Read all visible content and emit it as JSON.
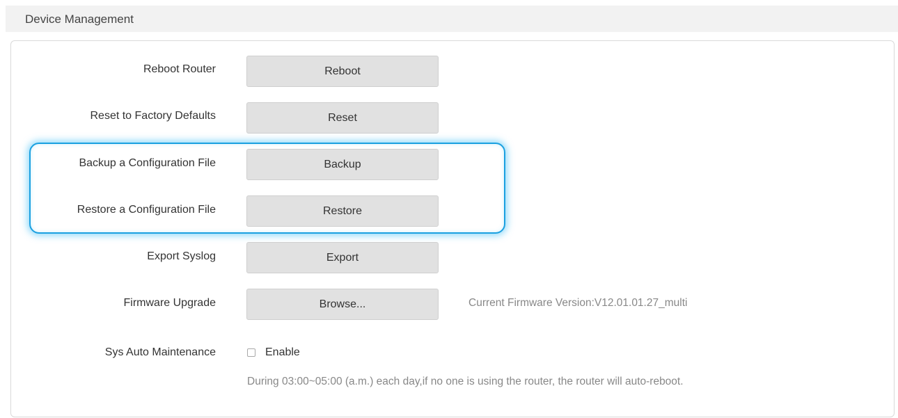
{
  "section": {
    "title": "Device Management"
  },
  "rows": {
    "reboot": {
      "label": "Reboot Router",
      "button": "Reboot"
    },
    "reset": {
      "label": "Reset to Factory Defaults",
      "button": "Reset"
    },
    "backup": {
      "label": "Backup a Configuration File",
      "button": "Backup"
    },
    "restore": {
      "label": "Restore a Configuration File",
      "button": "Restore"
    },
    "export": {
      "label": "Export Syslog",
      "button": "Export"
    },
    "firmware": {
      "label": "Firmware Upgrade",
      "button": "Browse...",
      "version_text": "Current Firmware Version:V12.01.01.27_multi"
    },
    "maintenance": {
      "label": "Sys Auto Maintenance",
      "checkbox_label": "Enable",
      "checked": false,
      "note": "During 03:00~05:00 (a.m.) each day,if no one is using the router, the router will auto-reboot."
    }
  },
  "colors": {
    "highlight": "#1aa0e0",
    "button_bg": "#e1e1e1",
    "muted_text": "#888888"
  }
}
